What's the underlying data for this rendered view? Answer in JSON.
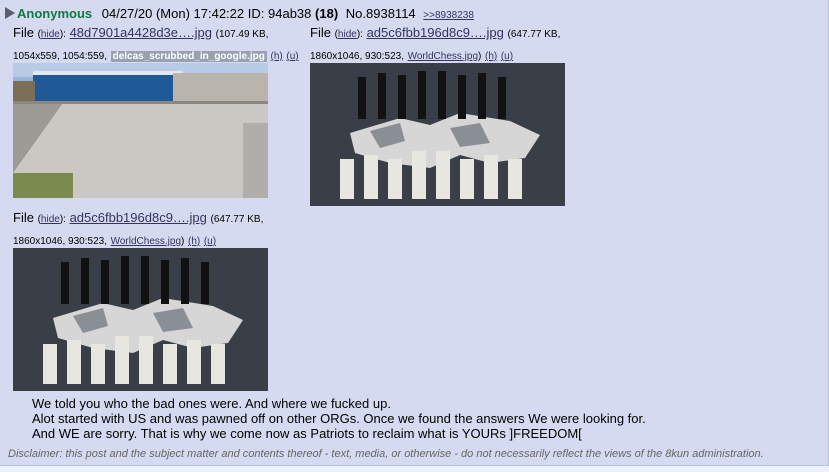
{
  "post": {
    "name": "Anonymous",
    "date": "04/27/20 (Mon) 17:42:22",
    "id_label": "ID:",
    "id": "94ab38",
    "count": "(18)",
    "postno": "No.8938114",
    "backlink": ">>8938238"
  },
  "files": [
    {
      "file_label": "File",
      "hide": "hide",
      "name": "48d7901a4428d3e….jpg",
      "size": "(107.49 KB,",
      "dims": "1054x559, 1054:559,",
      "original": "delcas_scrubbed_in_google.jpg",
      "h": "(h)",
      "u": "(u)",
      "thumb_icon": "building-photo-thumbnail"
    },
    {
      "file_label": "File",
      "hide": "hide",
      "name": "ad5c6fbb196d8c9….jpg",
      "size": "(647.77 KB,",
      "dims": "1860x1046, 930:523,",
      "original": "WorldChess.jpg",
      "h": "(h)",
      "u": "(u)",
      "thumb_icon": "world-chess-thumbnail"
    },
    {
      "file_label": "File",
      "hide": "hide",
      "name": "ad5c6fbb196d8c9….jpg",
      "size": "(647.77 KB,",
      "dims": "1860x1046, 930:523,",
      "original": "WorldChess.jpg",
      "h": "(h)",
      "u": "(u)",
      "thumb_icon": "world-chess-thumbnail"
    }
  ],
  "body": [
    "We told you who the bad ones were. And where we fucked up.",
    "Alot started with US and was pawned off on other ORGs. Once we found the answers We were looking for.",
    "And WE are sorry. That is why we come now as Patriots to reclaim what is YOURs ]FREEDOM["
  ],
  "disclaimer": "Disclaimer: this post and the subject matter and contents thereof - text, media, or otherwise - do not necessarily reflect the views of the 8kun administration.",
  "colors": {
    "post_bg": "#d6daf0",
    "name": "#117743",
    "link": "#34345c",
    "page_bg": "#eef2ff"
  }
}
